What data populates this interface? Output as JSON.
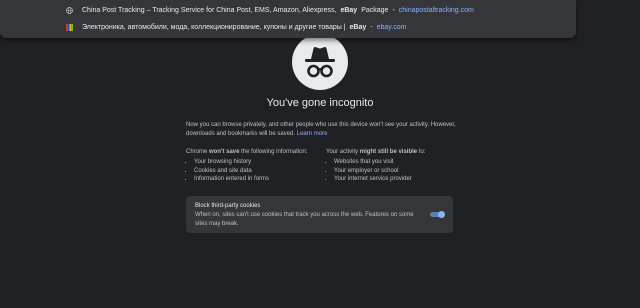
{
  "suggestions": [
    {
      "icon": "globe-icon",
      "prefix": "China Post Tracking – Tracking Service for China Post, EMS, Amazon, Aliexpress,",
      "bold": "eBay",
      "suffix": "Package",
      "dash": "-",
      "url": "chinapostaltracking.com"
    },
    {
      "icon": "ebay-favicon",
      "prefix": "Электроника, автомобили, мода, коллекционирование, купоны и другие товары |",
      "bold": "eBay",
      "suffix": "",
      "dash": "-",
      "url": "ebay.com"
    }
  ],
  "incognito": {
    "title": "You've gone incognito",
    "intro": "Now you can browse privately, and other people who use this device won't see your activity. However, downloads and bookmarks will be saved.",
    "learn_more": "Learn more",
    "left_heading_prefix": "Chrome ",
    "left_heading_bold": "won't save",
    "left_heading_suffix": " the following information:",
    "left_items": [
      "Your browsing history",
      "Cookies and site data",
      "Information entered in forms"
    ],
    "right_heading_prefix": "Your activity ",
    "right_heading_bold": "might still be visible",
    "right_heading_suffix": " to:",
    "right_items": [
      "Websites that you visit",
      "Your employer or school",
      "Your internet service provider"
    ]
  },
  "cookies": {
    "title": "Block third-party cookies",
    "description": "When on, sites can't use cookies that track you across the web. Features on some sites may break.",
    "toggle_on": true
  },
  "colors": {
    "background": "#202124",
    "link": "#8ab4f8",
    "card": "#35363a"
  }
}
